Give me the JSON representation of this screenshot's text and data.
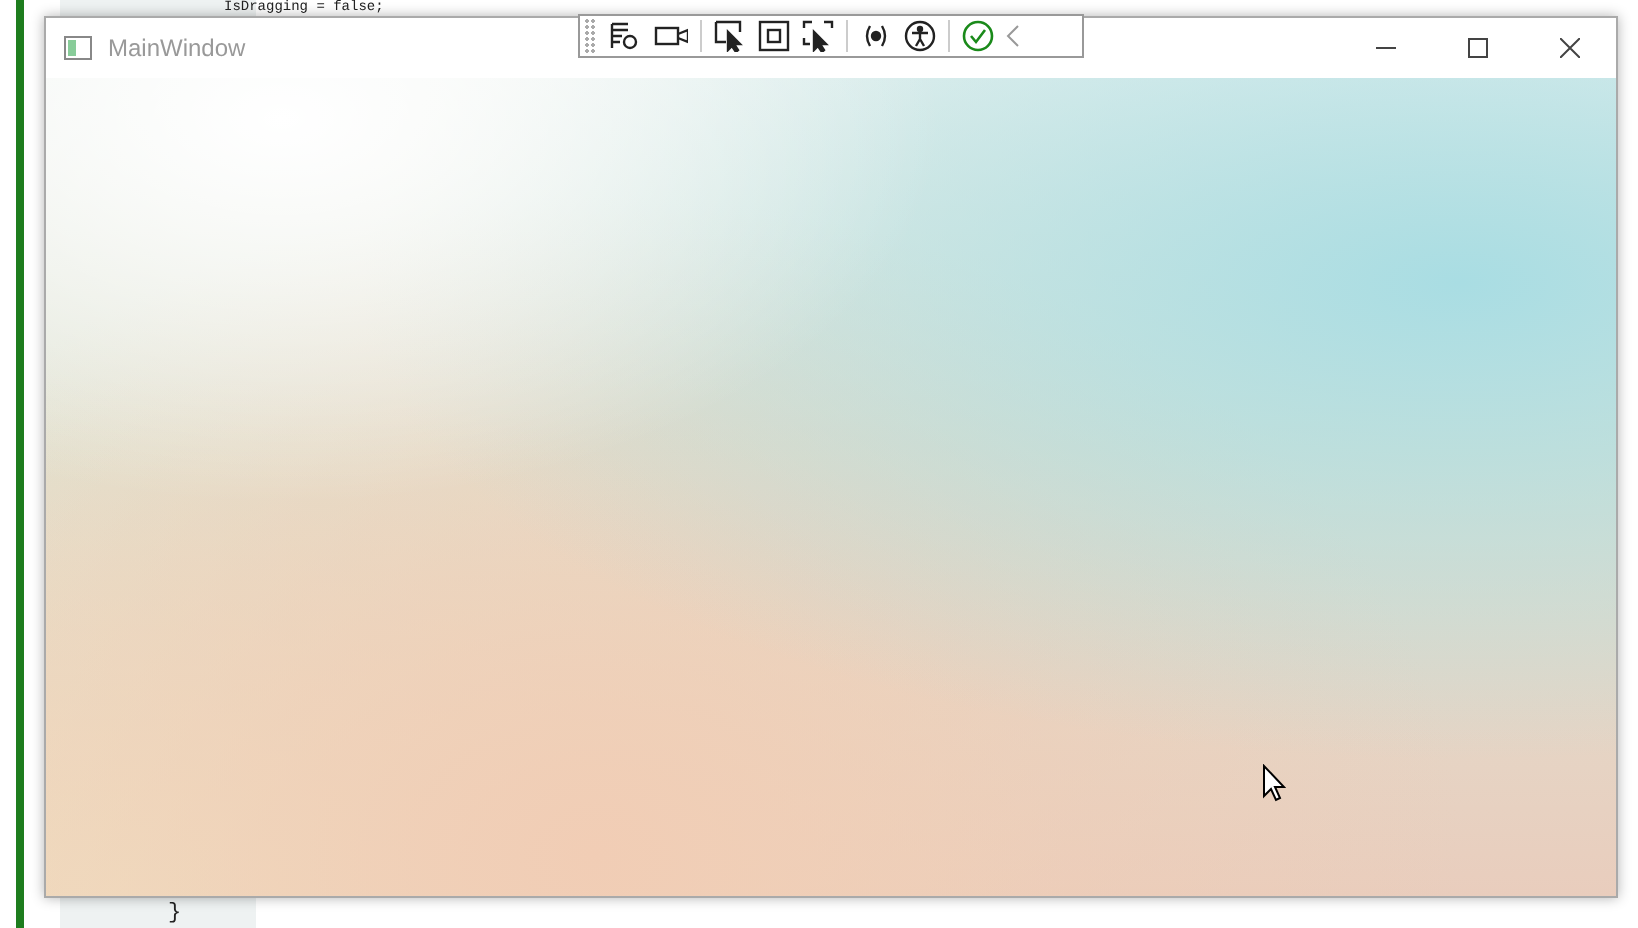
{
  "editor": {
    "lines": [
      "IsDragging = false;",
      "}"
    ]
  },
  "window": {
    "title": "MainWindow"
  }
}
